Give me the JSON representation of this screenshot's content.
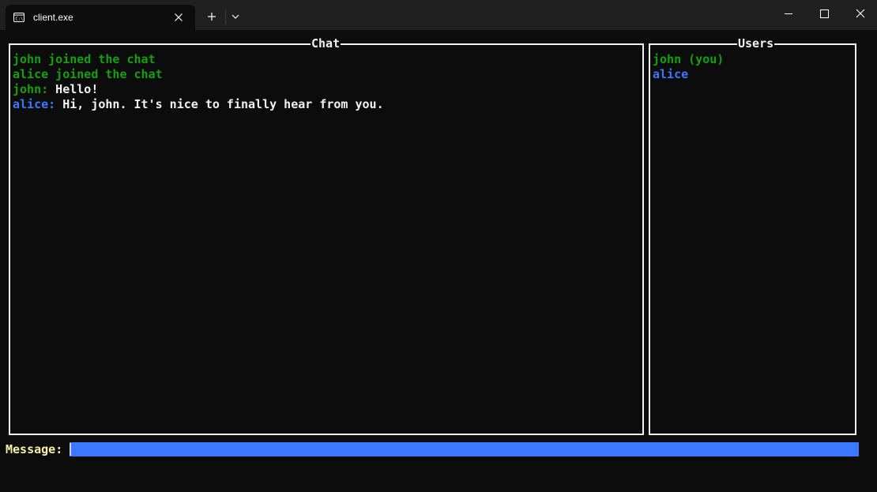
{
  "window": {
    "tab_title": "client.exe",
    "tab_icon": "terminal-icon",
    "new_tab_icon": "plus-icon",
    "dropdown_icon": "chevron-down-icon",
    "controls": [
      "minimize-icon",
      "maximize-icon",
      "close-icon"
    ]
  },
  "chat": {
    "title": "Chat",
    "messages": [
      {
        "type": "event",
        "text": "john joined the chat",
        "color": "#13a10e"
      },
      {
        "type": "event",
        "text": "alice joined the chat",
        "color": "#13a10e"
      },
      {
        "type": "message",
        "sender": "john:",
        "sender_color": "#13a10e",
        "text": " Hello!"
      },
      {
        "type": "message",
        "sender": "alice:",
        "sender_color": "#3b78ff",
        "text": " Hi, john. It's nice to finally hear from you."
      }
    ]
  },
  "users": {
    "title": "Users",
    "list": [
      {
        "name": "john (you)",
        "color": "#13a10e"
      },
      {
        "name": "alice",
        "color": "#3b78ff"
      }
    ]
  },
  "input": {
    "label": "Message: ",
    "value": ""
  },
  "colors": {
    "background": "#0c0c0c",
    "titlebar": "#202020",
    "border": "#f2f2f2",
    "green": "#13a10e",
    "blue": "#3b78ff",
    "label_yellow": "#f9f1a5"
  }
}
